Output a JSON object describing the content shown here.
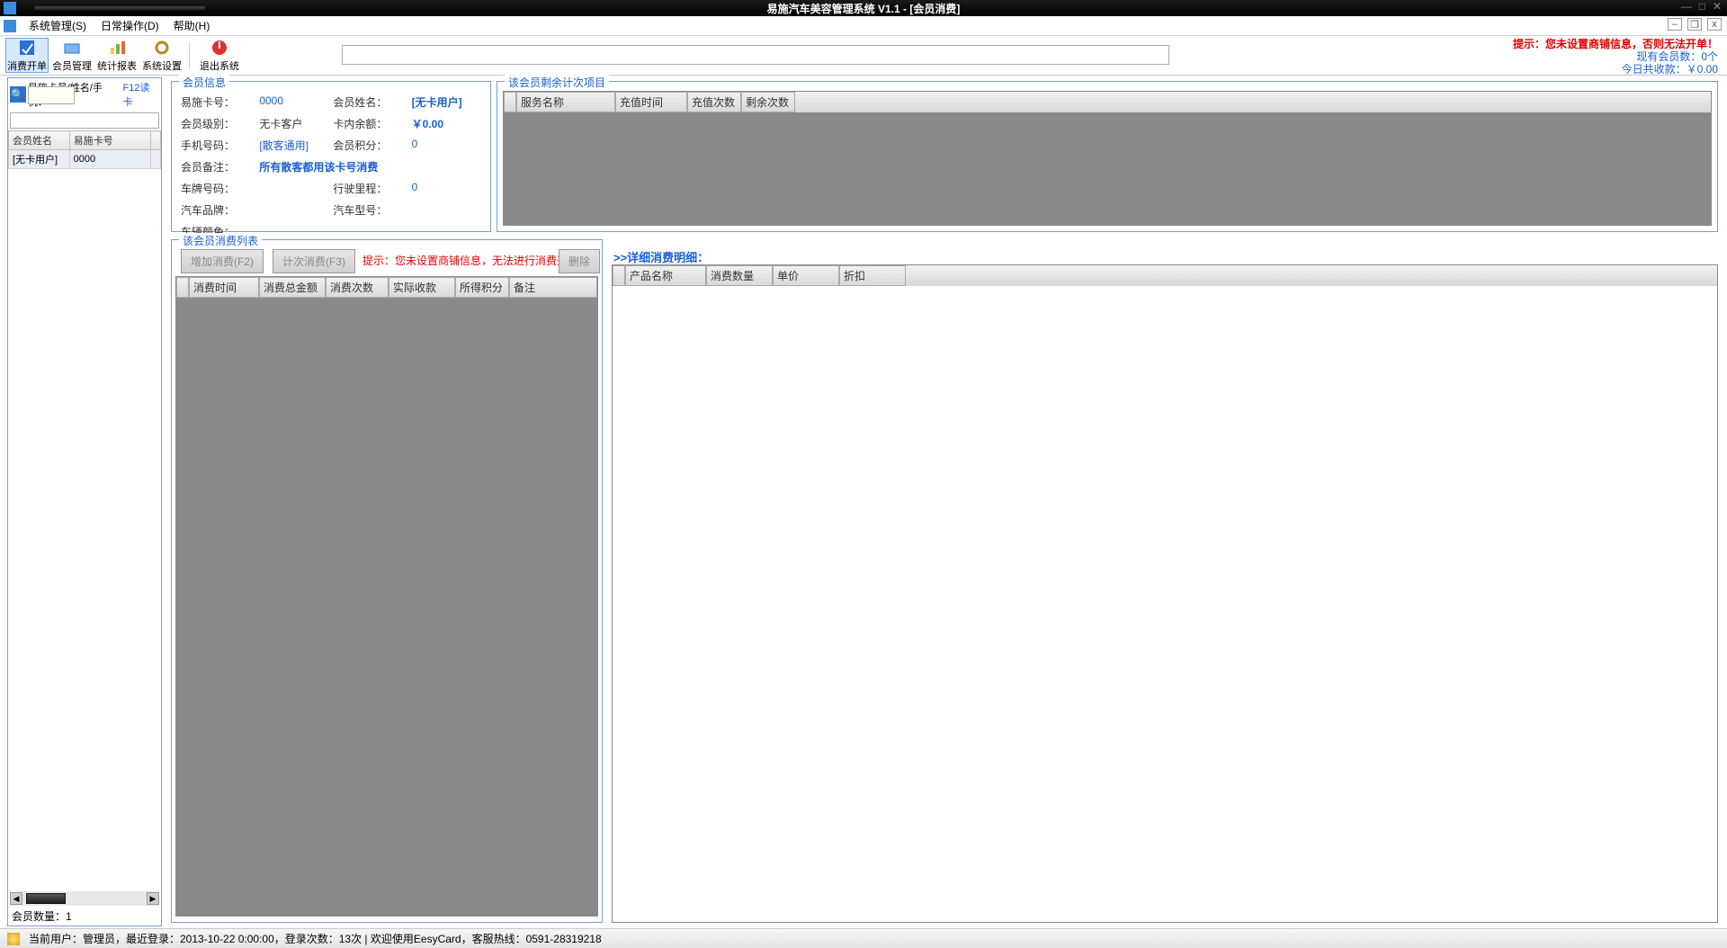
{
  "window": {
    "title": "易施汽车美容管理系统 V1.1 - [会员消费]"
  },
  "menubar": {
    "items": [
      "系统管理(S)",
      "日常操作(D)",
      "帮助(H)"
    ]
  },
  "toolbar": {
    "btns": [
      {
        "label": "消费开单",
        "icon": "order-icon"
      },
      {
        "label": "会员管理",
        "icon": "member-icon"
      },
      {
        "label": "统计报表",
        "icon": "report-icon"
      },
      {
        "label": "系统设置",
        "icon": "settings-icon"
      },
      {
        "label": "退出系统",
        "icon": "exit-icon"
      }
    ],
    "overlay_chip": "消费开单",
    "warn": "提示：您未设置商铺信息，否则无法开单！",
    "member_count": "现有会员数：0个",
    "today_total": "今日共收款：￥0.00"
  },
  "search": {
    "label": "易施卡号/姓名/手机：",
    "link": "F12读卡"
  },
  "member_grid": {
    "cols": [
      "会员姓名",
      "易施卡号",
      ""
    ],
    "row": [
      "[无卡用户]",
      "0000",
      ""
    ]
  },
  "member_count_text": "会员数量：1",
  "info": {
    "title": "会员信息",
    "card_no_l": "易施卡号：",
    "card_no_v": "0000",
    "name_l": "会员姓名：",
    "name_v": "[无卡用户]",
    "level_l": "会员级别：",
    "level_v": "无卡客户",
    "balance_l": "卡内余额：",
    "balance_v": "￥0.00",
    "phone_l": "手机号码：",
    "phone_v": "[散客通用]",
    "points_l": "会员积分：",
    "points_v": "0",
    "remark_l": "会员备注：",
    "remark_v": "所有散客都用该卡号消费",
    "plate_l": "车牌号码：",
    "plate_v": "",
    "mileage_l": "行驶里程：",
    "mileage_v": "0",
    "brand_l": "汽车品牌：",
    "brand_v": "",
    "model_l": "汽车型号：",
    "model_v": "",
    "color_l": "车辆颜色：",
    "color_v": ""
  },
  "remain": {
    "title": "该会员剩余计次项目",
    "cols": [
      "服务名称",
      "充值时间",
      "充值次数",
      "剩余次数"
    ]
  },
  "consume_list": {
    "title": "该会员消费列表",
    "btn_add": "增加消费(F2)",
    "btn_count": "计次消费(F3)",
    "btn_del": "删除",
    "warn": "提示：您未设置商铺信息，无法进行消费开单！",
    "cols": [
      "消费时间",
      "消费总金额",
      "消费次数",
      "实际收款",
      "所得积分",
      "备注"
    ]
  },
  "detail": {
    "title": ">>详细消费明细：",
    "cols": [
      "产品名称",
      "消费数量",
      "单价",
      "折扣"
    ]
  },
  "status": {
    "text": "当前用户：管理员，最近登录：2013-10-22 0:00:00，登录次数：13次    |    欢迎使用EesyCard，客服热线：0591-28319218"
  }
}
